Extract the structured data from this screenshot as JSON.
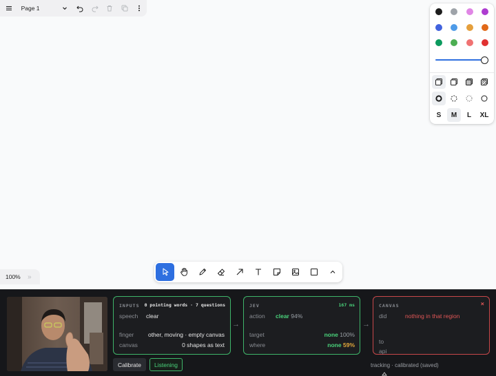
{
  "menu": {
    "page_label": "Page 1"
  },
  "style_panel": {
    "colors": [
      "#1d1d1d",
      "#9ea3a9",
      "#e086e5",
      "#ad3cd0",
      "#4263de",
      "#4e9be8",
      "#e59f3c",
      "#e16919",
      "#0c9a5e",
      "#4cae52",
      "#f07272",
      "#e03131"
    ],
    "selected_color_index": 0,
    "opacity": 1.0,
    "sizes": [
      "S",
      "M",
      "L",
      "XL"
    ],
    "selected_size": "M"
  },
  "zoom": {
    "label": "100%",
    "expand_glyph": "»"
  },
  "toolbar": {
    "tools": [
      "select",
      "hand",
      "draw",
      "eraser",
      "arrow",
      "text",
      "note",
      "image",
      "rectangle",
      "more"
    ],
    "active_tool": "select"
  },
  "inputs": {
    "title": "INPUTS",
    "summary": "0 pointing words · 7 questions",
    "speech_label": "speech",
    "speech_value": "clear",
    "finger_label": "finger",
    "finger_value": "other, moving · empty canvas",
    "canvas_label": "canvas",
    "canvas_value": "0 shapes as text"
  },
  "jev": {
    "title": "JEV",
    "latency": "167 ms",
    "action_label": "action",
    "action_value": "clear",
    "action_pct": "94%",
    "target_label": "target",
    "target_value": "none",
    "target_pct": "100%",
    "where_label": "where",
    "where_value": "none",
    "where_pct": "59%"
  },
  "canvas_card": {
    "title": "CANVAS",
    "close": "×",
    "did_label": "did",
    "did_value": "nothing in that region",
    "to_label": "to",
    "api_label": "api"
  },
  "buttons": {
    "calibrate": "Calibrate",
    "listening": "Listening"
  },
  "status": "tracking · calibrated (saved)",
  "arrows": {
    "first": "→",
    "second": "→"
  },
  "colors": {
    "green": "#4ad37b",
    "red": "#e05656",
    "accent_blue": "#2e6fe0"
  }
}
